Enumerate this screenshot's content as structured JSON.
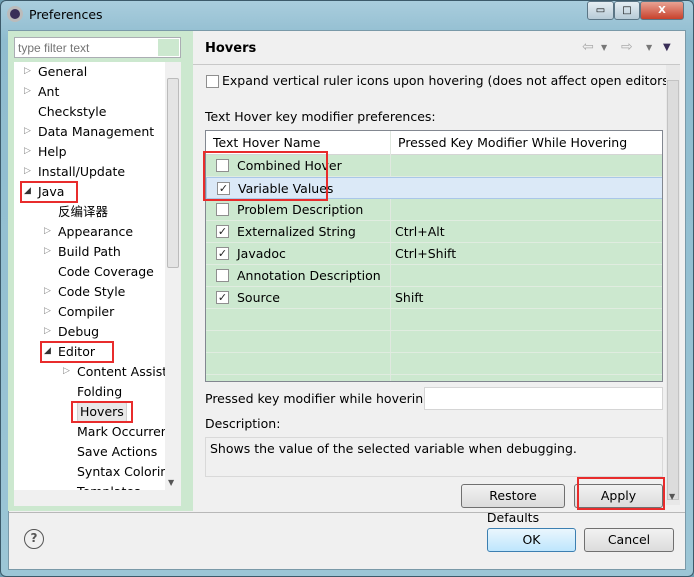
{
  "window": {
    "title": "Preferences",
    "minimize": "▭",
    "maximize": "□",
    "close": "X",
    "close_color": "#c8412c"
  },
  "filter": {
    "placeholder": "type filter text"
  },
  "tree": [
    {
      "label": "General",
      "level": 0,
      "expander": "collapsed"
    },
    {
      "label": "Ant",
      "level": 0,
      "expander": "collapsed"
    },
    {
      "label": "Checkstyle",
      "level": 0,
      "expander": "none"
    },
    {
      "label": "Data Management",
      "level": 0,
      "expander": "collapsed"
    },
    {
      "label": "Help",
      "level": 0,
      "expander": "collapsed"
    },
    {
      "label": "Install/Update",
      "level": 0,
      "expander": "collapsed"
    },
    {
      "label": "Java",
      "level": 0,
      "expander": "expanded",
      "highlighted": true
    },
    {
      "label": "反编译器",
      "level": 1,
      "expander": "none"
    },
    {
      "label": "Appearance",
      "level": 1,
      "expander": "collapsed"
    },
    {
      "label": "Build Path",
      "level": 1,
      "expander": "collapsed"
    },
    {
      "label": "Code Coverage",
      "level": 1,
      "expander": "none"
    },
    {
      "label": "Code Style",
      "level": 1,
      "expander": "collapsed"
    },
    {
      "label": "Compiler",
      "level": 1,
      "expander": "collapsed"
    },
    {
      "label": "Debug",
      "level": 1,
      "expander": "collapsed"
    },
    {
      "label": "Editor",
      "level": 1,
      "expander": "expanded",
      "highlighted": true
    },
    {
      "label": "Content Assist",
      "level": 2,
      "expander": "collapsed"
    },
    {
      "label": "Folding",
      "level": 2,
      "expander": "none"
    },
    {
      "label": "Hovers",
      "level": 2,
      "expander": "none",
      "selected": true,
      "highlighted": true
    },
    {
      "label": "Mark Occurrences",
      "level": 2,
      "expander": "none"
    },
    {
      "label": "Save Actions",
      "level": 2,
      "expander": "none"
    },
    {
      "label": "Syntax Coloring",
      "level": 2,
      "expander": "none"
    },
    {
      "label": "Templates",
      "level": 2,
      "expander": "none"
    }
  ],
  "page": {
    "title": "Hovers",
    "expand_checkbox": {
      "label": "Expand vertical ruler icons upon hovering (does not affect open editors)",
      "checked": false
    },
    "section_label": "Text Hover key modifier preferences:",
    "table": {
      "columns": [
        "Text Hover Name",
        "Pressed Key Modifier While Hovering"
      ],
      "rows": [
        {
          "name": "Combined Hover",
          "modifier": "",
          "checked": false
        },
        {
          "name": "Variable Values",
          "modifier": "",
          "checked": true,
          "selected": true
        },
        {
          "name": "Problem Description",
          "modifier": "",
          "checked": false
        },
        {
          "name": "Externalized String",
          "modifier": "Ctrl+Alt",
          "checked": true
        },
        {
          "name": "Javadoc",
          "modifier": "Ctrl+Shift",
          "checked": true
        },
        {
          "name": "Annotation Description",
          "modifier": "",
          "checked": false
        },
        {
          "name": "Source",
          "modifier": "Shift",
          "checked": true
        }
      ]
    },
    "modifier_label": "Pressed key modifier while hovering:",
    "modifier_value": "",
    "description_label": "Description:",
    "description": "Shows the value of the selected variable when debugging.",
    "restore_defaults": "Restore Defaults",
    "apply": "Apply"
  },
  "footer": {
    "help": "?",
    "ok": "OK",
    "cancel": "Cancel"
  },
  "colors": {
    "highlight_box": "#e82c2c",
    "panel_green": "#cce8cf",
    "selection": "#dbe9f7"
  }
}
